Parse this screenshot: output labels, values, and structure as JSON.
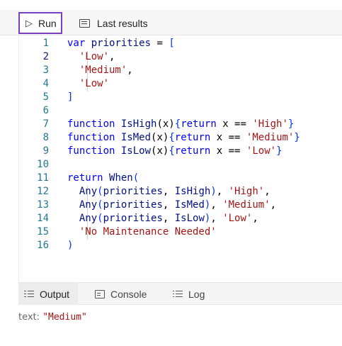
{
  "toolbar": {
    "run_label": "Run",
    "last_results_label": "Last results"
  },
  "editor": {
    "active_line": 2,
    "lines": [
      {
        "num": "1",
        "tokens": [
          {
            "t": "var",
            "c": "kw"
          },
          {
            "t": " "
          },
          {
            "t": "priorities",
            "c": "fn"
          },
          {
            "t": " = "
          },
          {
            "t": "[",
            "c": "br"
          }
        ]
      },
      {
        "num": "2",
        "tokens": [
          {
            "t": "  "
          },
          {
            "t": "'Low'",
            "c": "str"
          },
          {
            "t": ","
          }
        ]
      },
      {
        "num": "3",
        "tokens": [
          {
            "t": "  "
          },
          {
            "t": "'Medium'",
            "c": "str"
          },
          {
            "t": ","
          }
        ]
      },
      {
        "num": "4",
        "tokens": [
          {
            "t": "  "
          },
          {
            "t": "'Low'",
            "c": "str"
          }
        ]
      },
      {
        "num": "5",
        "tokens": [
          {
            "t": "]",
            "c": "br"
          }
        ]
      },
      {
        "num": "6",
        "tokens": []
      },
      {
        "num": "7",
        "tokens": [
          {
            "t": "function",
            "c": "kw"
          },
          {
            "t": " "
          },
          {
            "t": "IsHigh",
            "c": "fn"
          },
          {
            "t": "(x)"
          },
          {
            "t": "{",
            "c": "br"
          },
          {
            "t": "return",
            "c": "kw"
          },
          {
            "t": " x == "
          },
          {
            "t": "'High'",
            "c": "str"
          },
          {
            "t": "}",
            "c": "br"
          }
        ]
      },
      {
        "num": "8",
        "tokens": [
          {
            "t": "function",
            "c": "kw"
          },
          {
            "t": " "
          },
          {
            "t": "IsMed",
            "c": "fn"
          },
          {
            "t": "(x)"
          },
          {
            "t": "{",
            "c": "br"
          },
          {
            "t": "return",
            "c": "kw"
          },
          {
            "t": " x == "
          },
          {
            "t": "'Medium'",
            "c": "str"
          },
          {
            "t": "}",
            "c": "br"
          }
        ]
      },
      {
        "num": "9",
        "tokens": [
          {
            "t": "function",
            "c": "kw"
          },
          {
            "t": " "
          },
          {
            "t": "IsLow",
            "c": "fn"
          },
          {
            "t": "(x)"
          },
          {
            "t": "{",
            "c": "br"
          },
          {
            "t": "return",
            "c": "kw"
          },
          {
            "t": " x == "
          },
          {
            "t": "'Low'",
            "c": "str"
          },
          {
            "t": "}",
            "c": "br"
          }
        ]
      },
      {
        "num": "10",
        "tokens": []
      },
      {
        "num": "11",
        "tokens": [
          {
            "t": "return",
            "c": "kw"
          },
          {
            "t": " "
          },
          {
            "t": "When",
            "c": "fn"
          },
          {
            "t": "(",
            "c": "br"
          }
        ]
      },
      {
        "num": "12",
        "tokens": [
          {
            "t": "  "
          },
          {
            "t": "Any",
            "c": "fn"
          },
          {
            "t": "(",
            "c": "br"
          },
          {
            "t": "priorities",
            "c": "fn"
          },
          {
            "t": ", "
          },
          {
            "t": "IsHigh",
            "c": "fn"
          },
          {
            "t": ")",
            "c": "br"
          },
          {
            "t": ", "
          },
          {
            "t": "'High'",
            "c": "str"
          },
          {
            "t": ","
          }
        ]
      },
      {
        "num": "13",
        "tokens": [
          {
            "t": "  "
          },
          {
            "t": "Any",
            "c": "fn"
          },
          {
            "t": "(",
            "c": "br"
          },
          {
            "t": "priorities",
            "c": "fn"
          },
          {
            "t": ", "
          },
          {
            "t": "IsMed",
            "c": "fn"
          },
          {
            "t": ")",
            "c": "br"
          },
          {
            "t": ", "
          },
          {
            "t": "'Medium'",
            "c": "str"
          },
          {
            "t": ","
          }
        ]
      },
      {
        "num": "14",
        "tokens": [
          {
            "t": "  "
          },
          {
            "t": "Any",
            "c": "fn"
          },
          {
            "t": "(",
            "c": "br"
          },
          {
            "t": "priorities",
            "c": "fn"
          },
          {
            "t": ", "
          },
          {
            "t": "IsLow",
            "c": "fn"
          },
          {
            "t": ")",
            "c": "br"
          },
          {
            "t": ", "
          },
          {
            "t": "'Low'",
            "c": "str"
          },
          {
            "t": ","
          }
        ]
      },
      {
        "num": "15",
        "tokens": [
          {
            "t": "  "
          },
          {
            "t": "'No Maintenance Needed'",
            "c": "str"
          }
        ]
      },
      {
        "num": "16",
        "tokens": [
          {
            "t": ")",
            "c": "br"
          }
        ]
      }
    ]
  },
  "bottom_tabs": {
    "output_label": "Output",
    "console_label": "Console",
    "log_label": "Log"
  },
  "output": {
    "key": "text:",
    "value": "\"Medium\""
  }
}
